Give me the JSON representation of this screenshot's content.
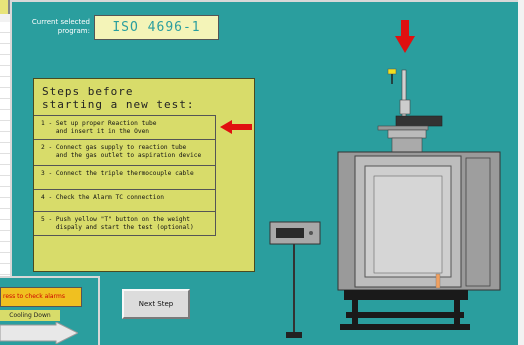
{
  "program": {
    "label": "Current selected program:",
    "value": "ISO 4696-1"
  },
  "steps": {
    "title": "Steps before\nstarting a new test:",
    "items": [
      {
        "text": "1 - Set up proper Reaction tube\n    and insert it in the Oven"
      },
      {
        "text": "2 - Connect gas supply to reaction tube\n    and the gas outlet to aspiration device"
      },
      {
        "text": "3 - Connect the triple thermocouple cable"
      },
      {
        "text": "4 - Check the Alarm TC connection"
      },
      {
        "text": "5 - Push yellow \"T\" button on the weight\n    dispaly and start the test (optional)"
      }
    ]
  },
  "buttons": {
    "next_step": "Next Step"
  },
  "popup": {
    "alarm_button": "ress to check alarms",
    "status_label": "Cooling Down"
  },
  "icons": {
    "current_step_indicator": "arrow-left-icon",
    "insertion_point": "arrow-down-icon",
    "process": "arrow-right-icon"
  },
  "colors": {
    "background": "#2a9e9e",
    "panel": "#d8dc6a",
    "program_box": "#f4f4b8",
    "arrow": "#e01010",
    "alarm_button": "#f0c020"
  }
}
